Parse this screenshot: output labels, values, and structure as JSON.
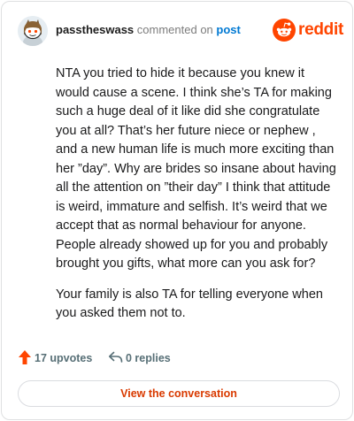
{
  "header": {
    "username": "passtheswass",
    "action_text": "commented on",
    "post_link": "post",
    "brand_name": "reddit",
    "brand_color": "#ff4500",
    "avatar_icon": "snoo-avatar-icon",
    "logo_icon": "reddit-snoo-icon"
  },
  "comment": {
    "paragraphs": [
      "NTA you tried to hide it because you knew it would cause a scene. I think she’s TA for making such a huge deal of it like did she congratulate you at all? That’s her future niece or nephew , and a new human life is much more exciting than her ”day”. Why are brides so insane about having all the attention on ”their day” I think that attitude is weird, immature and selfish. It’s weird that we accept that as normal behaviour for anyone. People already showed up for you and probably brought you gifts, what more can you ask for?",
      "Your family is also TA for telling everyone when you asked them not to."
    ]
  },
  "actions": {
    "upvotes_label": "17 upvotes",
    "replies_label": "0 replies",
    "upvote_icon": "upvote-arrow-icon",
    "reply_icon": "reply-arrow-icon",
    "upvote_color": "#ff4500"
  },
  "footer": {
    "view_button_label": "View the conversation",
    "button_text_color": "#d93a00"
  }
}
